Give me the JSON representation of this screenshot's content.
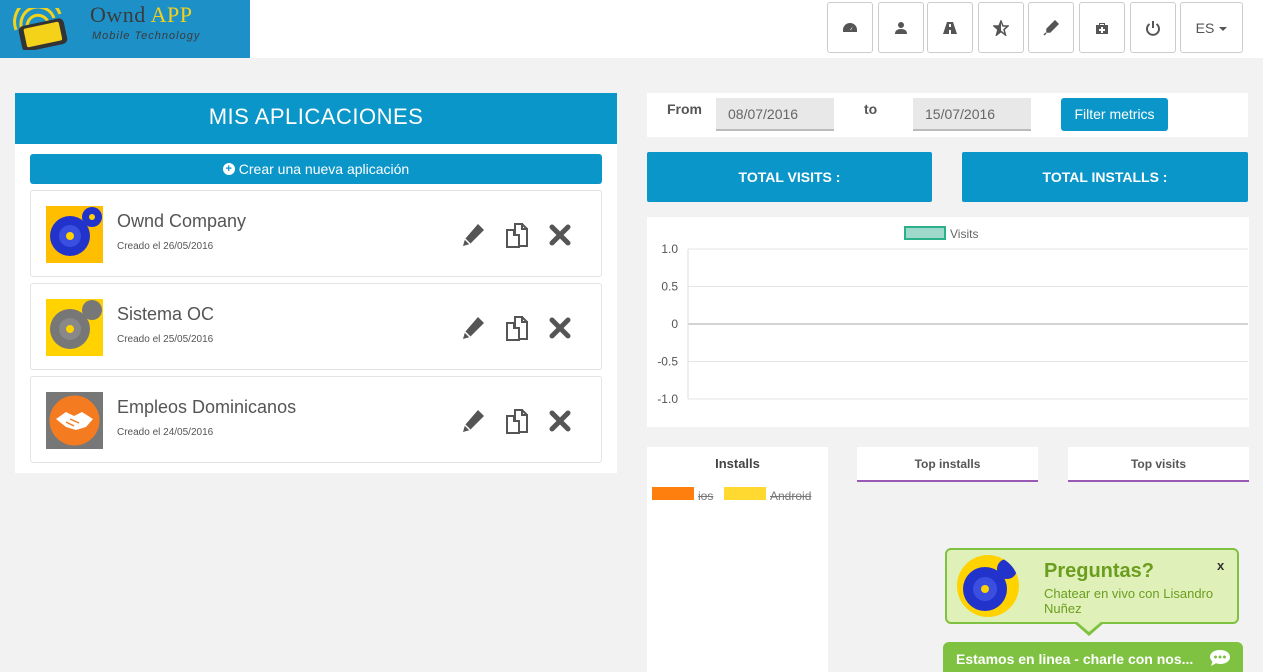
{
  "logo": {
    "brand": "Ownd",
    "brand_app": "APP",
    "tagline": "Mobile Technology"
  },
  "nav": {
    "icons": [
      "dashboard-icon",
      "user-icon",
      "road-icon",
      "star-half-icon",
      "tint-icon",
      "medkit-icon",
      "power-icon"
    ],
    "language": "ES"
  },
  "apps_panel": {
    "title": "MIS APLICACIONES",
    "create_label": "Crear una nueva aplicación",
    "apps": [
      {
        "name": "Ownd Company",
        "created": "Creado el 26/05/2016"
      },
      {
        "name": "Sistema OC",
        "created": "Creado el 25/05/2016"
      },
      {
        "name": "Empleos Dominicanos",
        "created": "Creado el 24/05/2016"
      }
    ]
  },
  "filter": {
    "from_label": "From",
    "from_value": "08/07/2016",
    "to_label": "to",
    "to_value": "15/07/2016",
    "button": "Filter metrics"
  },
  "totals": {
    "visits": "TOTAL VISITS :",
    "installs": "TOTAL INSTALLS :"
  },
  "chart_data": {
    "type": "line",
    "series": [
      {
        "name": "Visits",
        "values": [],
        "color": "#9fd9cc"
      }
    ],
    "yticks": [
      "1.0",
      "0.5",
      "0",
      "-0.5",
      "-1.0"
    ],
    "ylim": [
      -1.0,
      1.0
    ],
    "grid": true,
    "legend": "top-center"
  },
  "installs": {
    "title": "Installs",
    "legend": [
      {
        "label": "ios",
        "color": "#ff7f0e"
      },
      {
        "label": "Android",
        "color": "#ffd92f"
      }
    ]
  },
  "tabs": {
    "top_installs": "Top installs",
    "top_visits": "Top visits"
  },
  "chat": {
    "question": "Preguntas?",
    "subtitle": "Chatear en vivo con Lisandro Nuñez",
    "close": "x",
    "bar_label": "Estamos en linea - charle con nos..."
  },
  "colors": {
    "primary": "#0a96c8",
    "chat_green": "#7fc241",
    "tab_underline": "#9b59b6"
  }
}
